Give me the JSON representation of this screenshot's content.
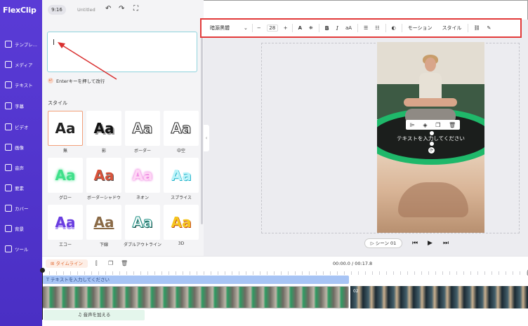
{
  "app": {
    "logo_text": "FlexClip"
  },
  "header": {
    "ratio": "9:16",
    "project_title": "Untitled"
  },
  "sidebar": {
    "items": [
      {
        "label": "テンプレ...",
        "icon": "template-icon"
      },
      {
        "label": "メディア",
        "icon": "media-icon"
      },
      {
        "label": "テキスト",
        "icon": "text-icon"
      },
      {
        "label": "字幕",
        "icon": "subtitle-icon"
      },
      {
        "label": "ビデオ",
        "icon": "video-icon"
      },
      {
        "label": "画像",
        "icon": "image-icon"
      },
      {
        "label": "音声",
        "icon": "audio-icon"
      },
      {
        "label": "要素",
        "icon": "elements-icon"
      },
      {
        "label": "カバー",
        "icon": "cover-icon"
      },
      {
        "label": "背景",
        "icon": "background-icon"
      },
      {
        "label": "ツール",
        "icon": "tools-icon"
      }
    ]
  },
  "text_panel": {
    "input_value": "",
    "enter_hint": "Enterキーを押して改行",
    "style_heading": "スタイル",
    "styles": [
      {
        "label": "無",
        "sample": "Aa"
      },
      {
        "label": "影",
        "sample": "Aa"
      },
      {
        "label": "ボーダー",
        "sample": "Aa"
      },
      {
        "label": "中空",
        "sample": "Aa"
      },
      {
        "label": "グロー",
        "sample": "Aa"
      },
      {
        "label": "ボーダーシャドウ",
        "sample": "Aa"
      },
      {
        "label": "ネオン",
        "sample": "Aa"
      },
      {
        "label": "スプライス",
        "sample": "Aa"
      },
      {
        "label": "エコー",
        "sample": "Aa"
      },
      {
        "label": "下線",
        "sample": "Aa"
      },
      {
        "label": "ダブルアウトライン",
        "sample": "Aa"
      },
      {
        "label": "3D",
        "sample": "Aa"
      }
    ]
  },
  "toolbar": {
    "font_name": "暗源黑體",
    "font_size": "28",
    "motion_label": "モーション",
    "style_label": "スタイル"
  },
  "canvas": {
    "overlay_text": "テキストを入力してください",
    "accent_color": "#1fb86a"
  },
  "playback": {
    "scene_label": "シーン 01"
  },
  "timeline": {
    "label": "タイムライン",
    "time": "00:00.0 / 00:17.8",
    "text_track": "テキストを入力してください",
    "clip2_number": "02",
    "add_audio": "音声を加える"
  }
}
